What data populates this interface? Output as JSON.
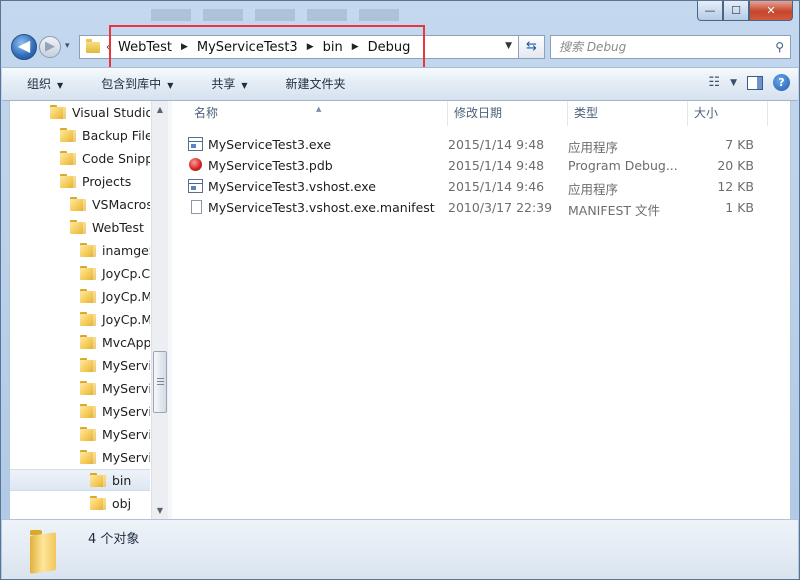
{
  "window": {
    "caption_buttons": {
      "minimize": "—",
      "maximize": "☐",
      "close": "✕"
    }
  },
  "nav": {
    "back_icon": "◀",
    "forward_icon": "▶",
    "history_icon": "▾",
    "address_chevron": "‹",
    "breadcrumbs": [
      "WebTest",
      "MyServiceTest3",
      "bin",
      "Debug"
    ],
    "address_dropdown": "▼",
    "refresh_icon": "⇆",
    "search_placeholder": "搜索 Debug",
    "search_icon": "⚲"
  },
  "toolbar": {
    "organize": "组织",
    "include_in_library": "包含到库中",
    "share": "共享",
    "new_folder": "新建文件夹",
    "dropdown_arrow": "▼",
    "views_icon": "☷",
    "help_icon": "?"
  },
  "tree": [
    {
      "label": "Visual Studio",
      "indent": 0
    },
    {
      "label": "Backup Files",
      "indent": 1
    },
    {
      "label": "Code Snipp",
      "indent": 1
    },
    {
      "label": "Projects",
      "indent": 1
    },
    {
      "label": "VSMacros",
      "indent": 2
    },
    {
      "label": "WebTest",
      "indent": 2
    },
    {
      "label": "inamgeS",
      "indent": 3
    },
    {
      "label": "JoyCp.Cc",
      "indent": 3
    },
    {
      "label": "JoyCp.M",
      "indent": 3
    },
    {
      "label": "JoyCp.M",
      "indent": 3
    },
    {
      "label": "MvcApp",
      "indent": 3
    },
    {
      "label": "MyServic",
      "indent": 3
    },
    {
      "label": "MyServic",
      "indent": 3
    },
    {
      "label": "MyServic",
      "indent": 3
    },
    {
      "label": "MyServic",
      "indent": 3
    },
    {
      "label": "MyServic",
      "indent": 3
    },
    {
      "label": "bin",
      "indent": 4,
      "selected": true
    },
    {
      "label": "obj",
      "indent": 4
    }
  ],
  "scrollbar": {
    "up": "▲",
    "down": "▼"
  },
  "columns": {
    "name": "名称",
    "date": "修改日期",
    "type": "类型",
    "size": "大小",
    "sort_indicator": "▲"
  },
  "files": [
    {
      "name": "MyServiceTest3.exe",
      "date": "2015/1/14 9:48",
      "type": "应用程序",
      "size": "7 KB",
      "icon": "exe-icon"
    },
    {
      "name": "MyServiceTest3.pdb",
      "date": "2015/1/14 9:48",
      "type": "Program Debug...",
      "size": "20 KB",
      "icon": "pdb-icon"
    },
    {
      "name": "MyServiceTest3.vshost.exe",
      "date": "2015/1/14 9:46",
      "type": "应用程序",
      "size": "12 KB",
      "icon": "exe-icon"
    },
    {
      "name": "MyServiceTest3.vshost.exe.manifest",
      "date": "2010/3/17 22:39",
      "type": "MANIFEST 文件",
      "size": "1 KB",
      "icon": "document-icon"
    }
  ],
  "status": {
    "text": "4 个对象"
  },
  "colors": {
    "highlight": "#e8363c",
    "accent": "#2e6bb9"
  }
}
